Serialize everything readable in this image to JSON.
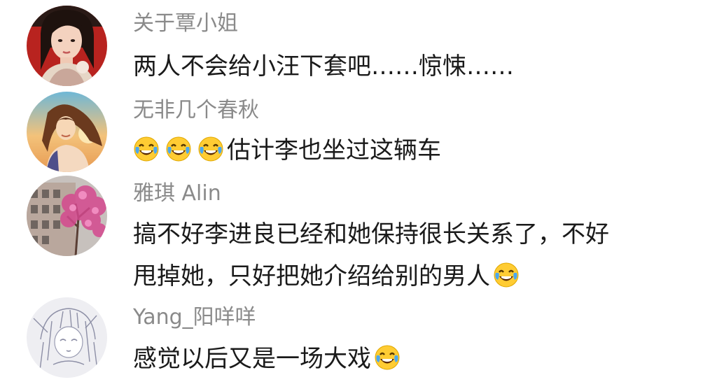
{
  "comments": [
    {
      "username": "关于覃小姐",
      "lines": [
        "两人不会给小汪下套吧……惊悚……"
      ],
      "avatar_icon": "avatar-woman-portrait-icon"
    },
    {
      "username": "无非几个春秋",
      "lines": [
        "估计李也坐过这辆车"
      ],
      "leading_emoji": "tears-of-joy-emoji",
      "leading_emoji_count": 3,
      "avatar_icon": "avatar-anime-girl-sunset-icon"
    },
    {
      "username": "雅琪 Alin",
      "lines": [
        "搞不好李进良已经和她保持很长关系了，不好",
        "甩掉她，只好把她介绍给别的男人"
      ],
      "trailing_emoji": "tears-of-joy-emoji",
      "avatar_icon": "avatar-blossom-tree-building-icon"
    },
    {
      "username": "Yang_阳咩咩",
      "lines": [
        "感觉以后又是一场大戏"
      ],
      "trailing_emoji": "tears-of-joy-emoji",
      "avatar_icon": "avatar-sketch-anime-girl-icon"
    }
  ],
  "colors": {
    "username": "#8a8a8a",
    "text": "#1a1a1a",
    "background": "#ffffff",
    "emoji_face": "#ffcc33",
    "emoji_tear": "#4aa8f0"
  }
}
